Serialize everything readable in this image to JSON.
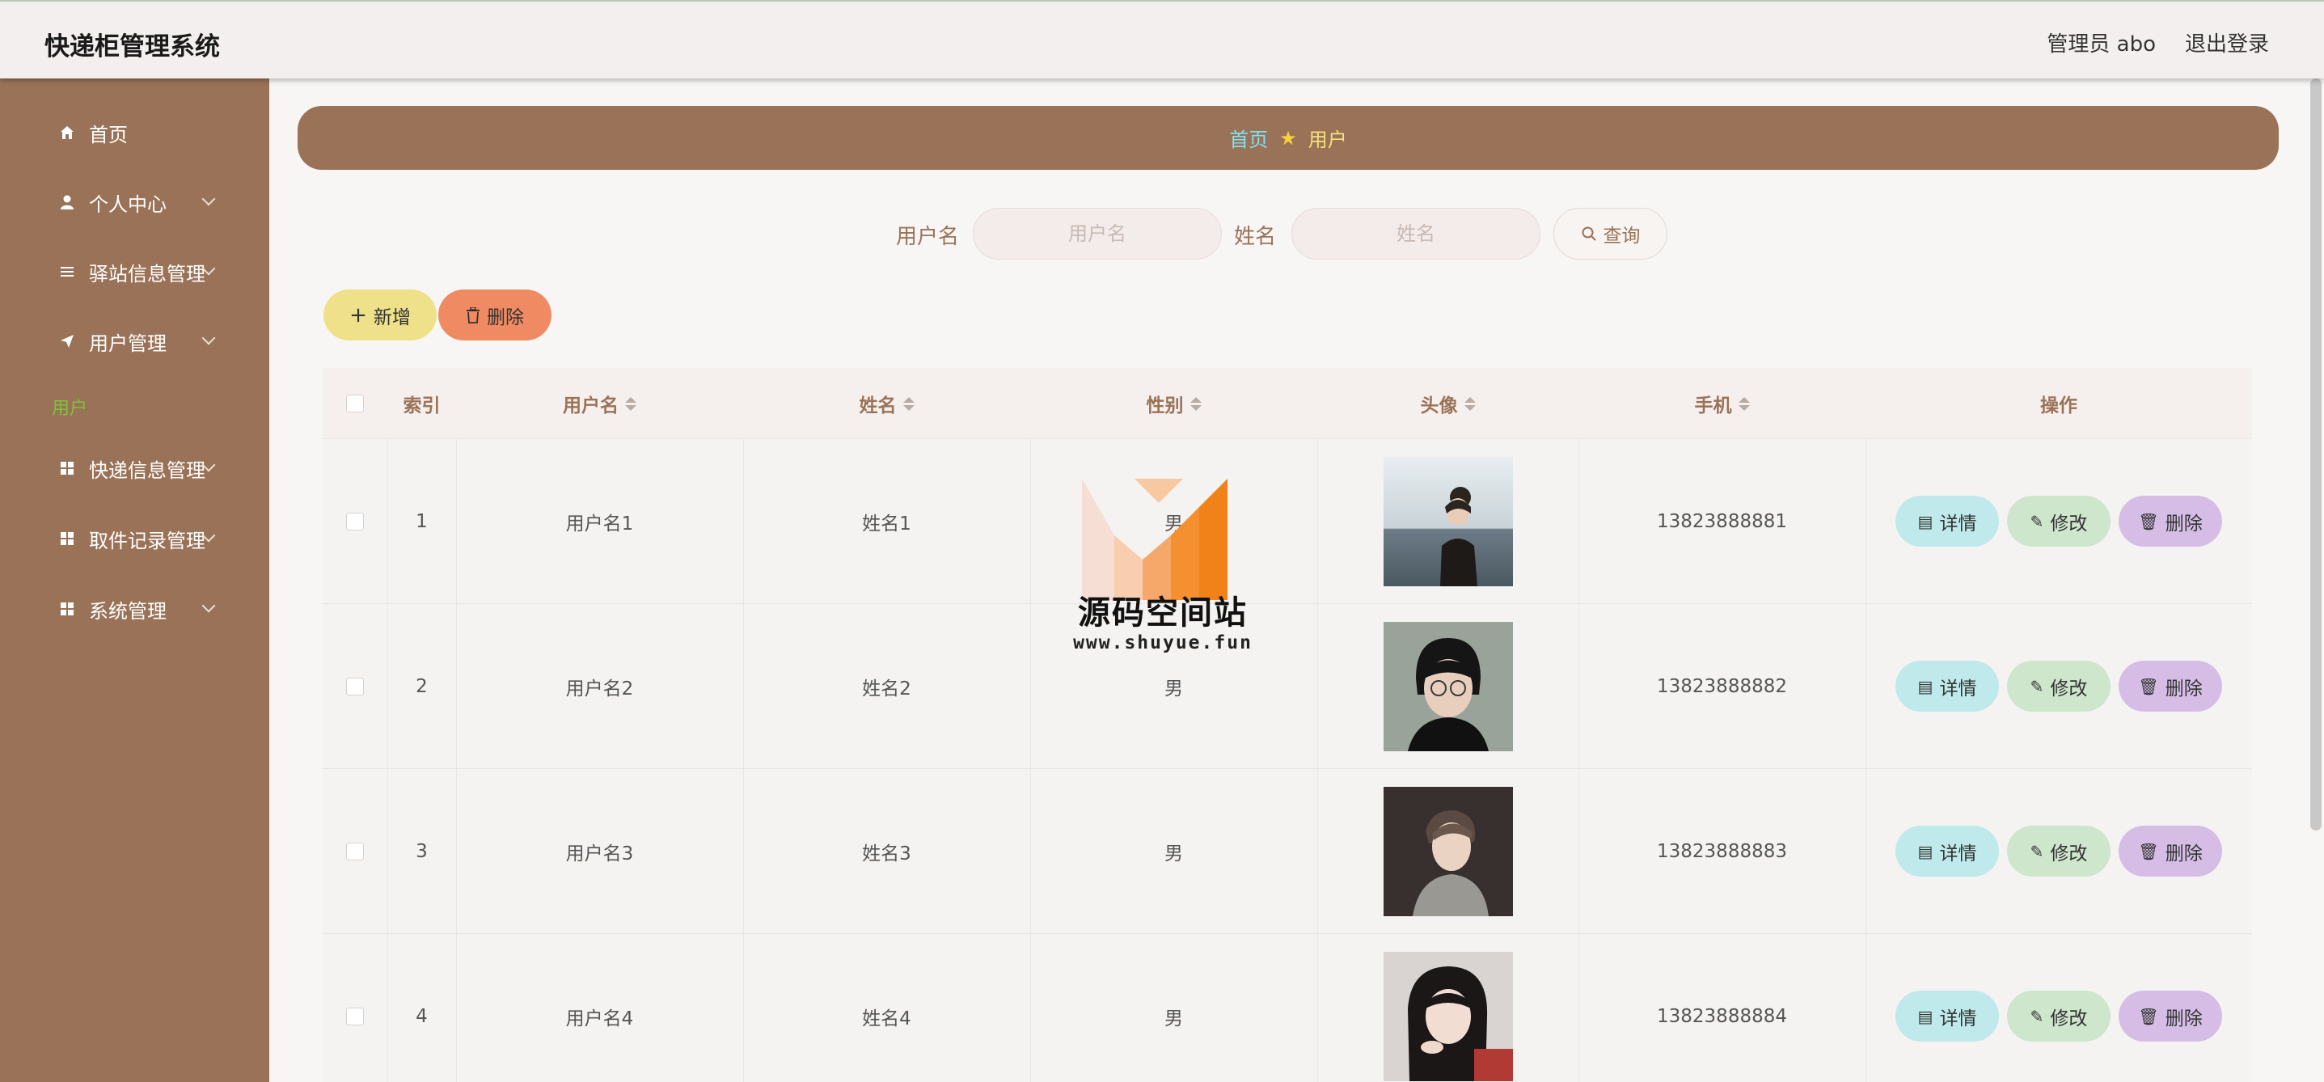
{
  "app": {
    "title": "快递柜管理系统",
    "user": "管理员 abo",
    "logout": "退出登录"
  },
  "sidebar": {
    "items": [
      {
        "label": "首页",
        "icon": "home-icon"
      },
      {
        "label": "个人中心",
        "icon": "user-icon"
      },
      {
        "label": "驿站信息管理",
        "icon": "list-icon"
      },
      {
        "label": "用户管理",
        "icon": "send-icon"
      },
      {
        "label": "快递信息管理",
        "icon": "grid-icon"
      },
      {
        "label": "取件记录管理",
        "icon": "grid-icon"
      },
      {
        "label": "系统管理",
        "icon": "grid-icon"
      }
    ],
    "sub_active": "用户"
  },
  "breadcrumb": {
    "home": "首页",
    "current": "用户"
  },
  "search": {
    "username_label": "用户名",
    "username_placeholder": "用户名",
    "name_label": "姓名",
    "name_placeholder": "姓名",
    "query_label": "查询"
  },
  "actions": {
    "add_label": "新增",
    "delete_label": "删除"
  },
  "table": {
    "headers": [
      "索引",
      "用户名",
      "姓名",
      "性别",
      "头像",
      "手机",
      "操作"
    ],
    "rows": [
      {
        "index": "1",
        "username": "用户名1",
        "name": "姓名1",
        "gender": "男",
        "phone": "13823888881"
      },
      {
        "index": "2",
        "username": "用户名2",
        "name": "姓名2",
        "gender": "男",
        "phone": "13823888882"
      },
      {
        "index": "3",
        "username": "用户名3",
        "name": "姓名3",
        "gender": "男",
        "phone": "13823888883"
      },
      {
        "index": "4",
        "username": "用户名4",
        "name": "姓名4",
        "gender": "男",
        "phone": "13823888884"
      }
    ],
    "row_actions": {
      "detail": "详情",
      "edit": "修改",
      "delete": "删除"
    }
  },
  "watermark": {
    "title": "源码空间站",
    "url": "www.shuyue.fun"
  },
  "colors": {
    "sidebar": "#9a7257",
    "accent_green": "#7fc23c",
    "add": "#efe08a",
    "delete": "#f08a63"
  }
}
